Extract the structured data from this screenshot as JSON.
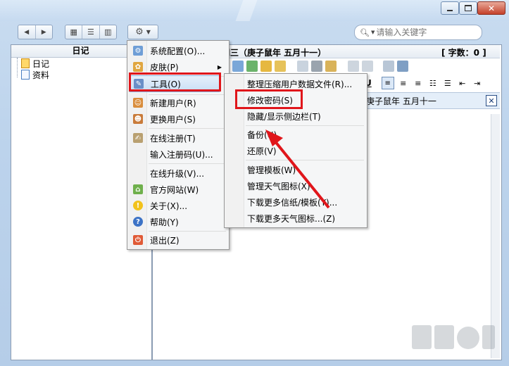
{
  "toolbar": {
    "nav_back_icon": "left-arrow-icon",
    "nav_forward_icon": "right-arrow-icon",
    "view_icons": [
      "grid-view-icon",
      "list-view-icon",
      "columns-view-icon"
    ],
    "settings_icon": "gear-icon",
    "search_placeholder": "请输入关键字"
  },
  "sidebar": {
    "title": "日记",
    "items": [
      {
        "label": "日记",
        "icon": "diary-icon"
      },
      {
        "label": "资料",
        "icon": "document-icon"
      }
    ]
  },
  "editor": {
    "date_line_a": "期三（庚子鼠年  五月十一）",
    "word_count": "[ 字数：0 ]",
    "date_line_b": "庚子鼠年  五月十一",
    "format_buttons": [
      "U"
    ]
  },
  "main_menu": {
    "items": [
      {
        "label": "系统配置(O)...",
        "icon": "config-icon"
      },
      {
        "label": "皮肤(P)",
        "icon": "skin-icon",
        "submenu": true
      },
      {
        "label": "工具(O)",
        "icon": "tools-icon",
        "highlighted": true
      },
      {
        "label": "新建用户(R)",
        "icon": "new-user-icon"
      },
      {
        "label": "更换用户(S)",
        "icon": "switch-user-icon"
      },
      {
        "label": "在线注册(T)",
        "icon": "register-icon"
      },
      {
        "label": "输入注册码(U)...",
        "icon": ""
      },
      {
        "label": "在线升级(V)...",
        "icon": ""
      },
      {
        "label": "官方网站(W)",
        "icon": "home-icon"
      },
      {
        "label": "关于(X)...",
        "icon": "info-icon"
      },
      {
        "label": "帮助(Y)",
        "icon": "help-icon"
      },
      {
        "label": "退出(Z)",
        "icon": "exit-icon"
      }
    ]
  },
  "tools_submenu": {
    "items": [
      {
        "label": "整理压缩用户数据文件(R)..."
      },
      {
        "label": "修改密码(S)",
        "highlighted": true
      },
      {
        "label": "隐藏/显示侧边栏(T)"
      },
      {
        "label": "备份(U)"
      },
      {
        "label": "还原(V)"
      },
      {
        "label": "管理模板(W)"
      },
      {
        "label": "管理天气图标(X)"
      },
      {
        "label": "下载更多信纸/模板(Y)..."
      },
      {
        "label": "下载更多天气图标...(Z)"
      }
    ]
  },
  "colors": {
    "highlight_box": "#e0161b",
    "arrow": "#e0161b"
  }
}
